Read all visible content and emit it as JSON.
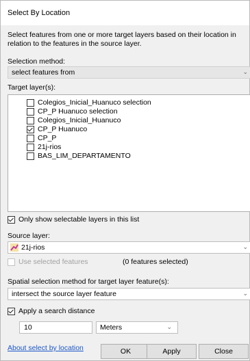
{
  "window": {
    "title": "Select By Location"
  },
  "description": "Select features from one or more target layers based on their location in relation to the features in the source layer.",
  "selection_method": {
    "label": "Selection method:",
    "value": "select features from"
  },
  "target_layers": {
    "label": "Target layer(s):",
    "items": [
      {
        "label": "Colegios_Inicial_Huanuco selection",
        "checked": false
      },
      {
        "label": "CP_P Huanuco selection",
        "checked": false
      },
      {
        "label": "Colegios_Inicial_Huanuco",
        "checked": false
      },
      {
        "label": "CP_P Huanuco",
        "checked": true
      },
      {
        "label": "CP_P",
        "checked": false
      },
      {
        "label": "21j-rios",
        "checked": false
      },
      {
        "label": "BAS_LIM_DEPARTAMENTO",
        "checked": false
      }
    ]
  },
  "only_selectable": {
    "label": "Only show selectable layers in this list",
    "checked": true
  },
  "source_layer": {
    "label": "Source layer:",
    "value": "21j-rios",
    "icon": "polyline-layer-icon"
  },
  "use_selected": {
    "label": "Use selected features",
    "checked": false,
    "count_text": "(0 features selected)"
  },
  "spatial_method": {
    "label": "Spatial selection method for target layer feature(s):",
    "value": "intersect the source layer feature"
  },
  "search_distance": {
    "label": "Apply a search distance",
    "checked": true,
    "value": "10",
    "units": "Meters"
  },
  "footer": {
    "help_link": "About select by location",
    "ok": "OK",
    "apply": "Apply",
    "close": "Close"
  },
  "colors": {
    "link": "#1a56c8",
    "dialog_bg": "#f0f0f0",
    "list_bg": "#ffffff"
  }
}
